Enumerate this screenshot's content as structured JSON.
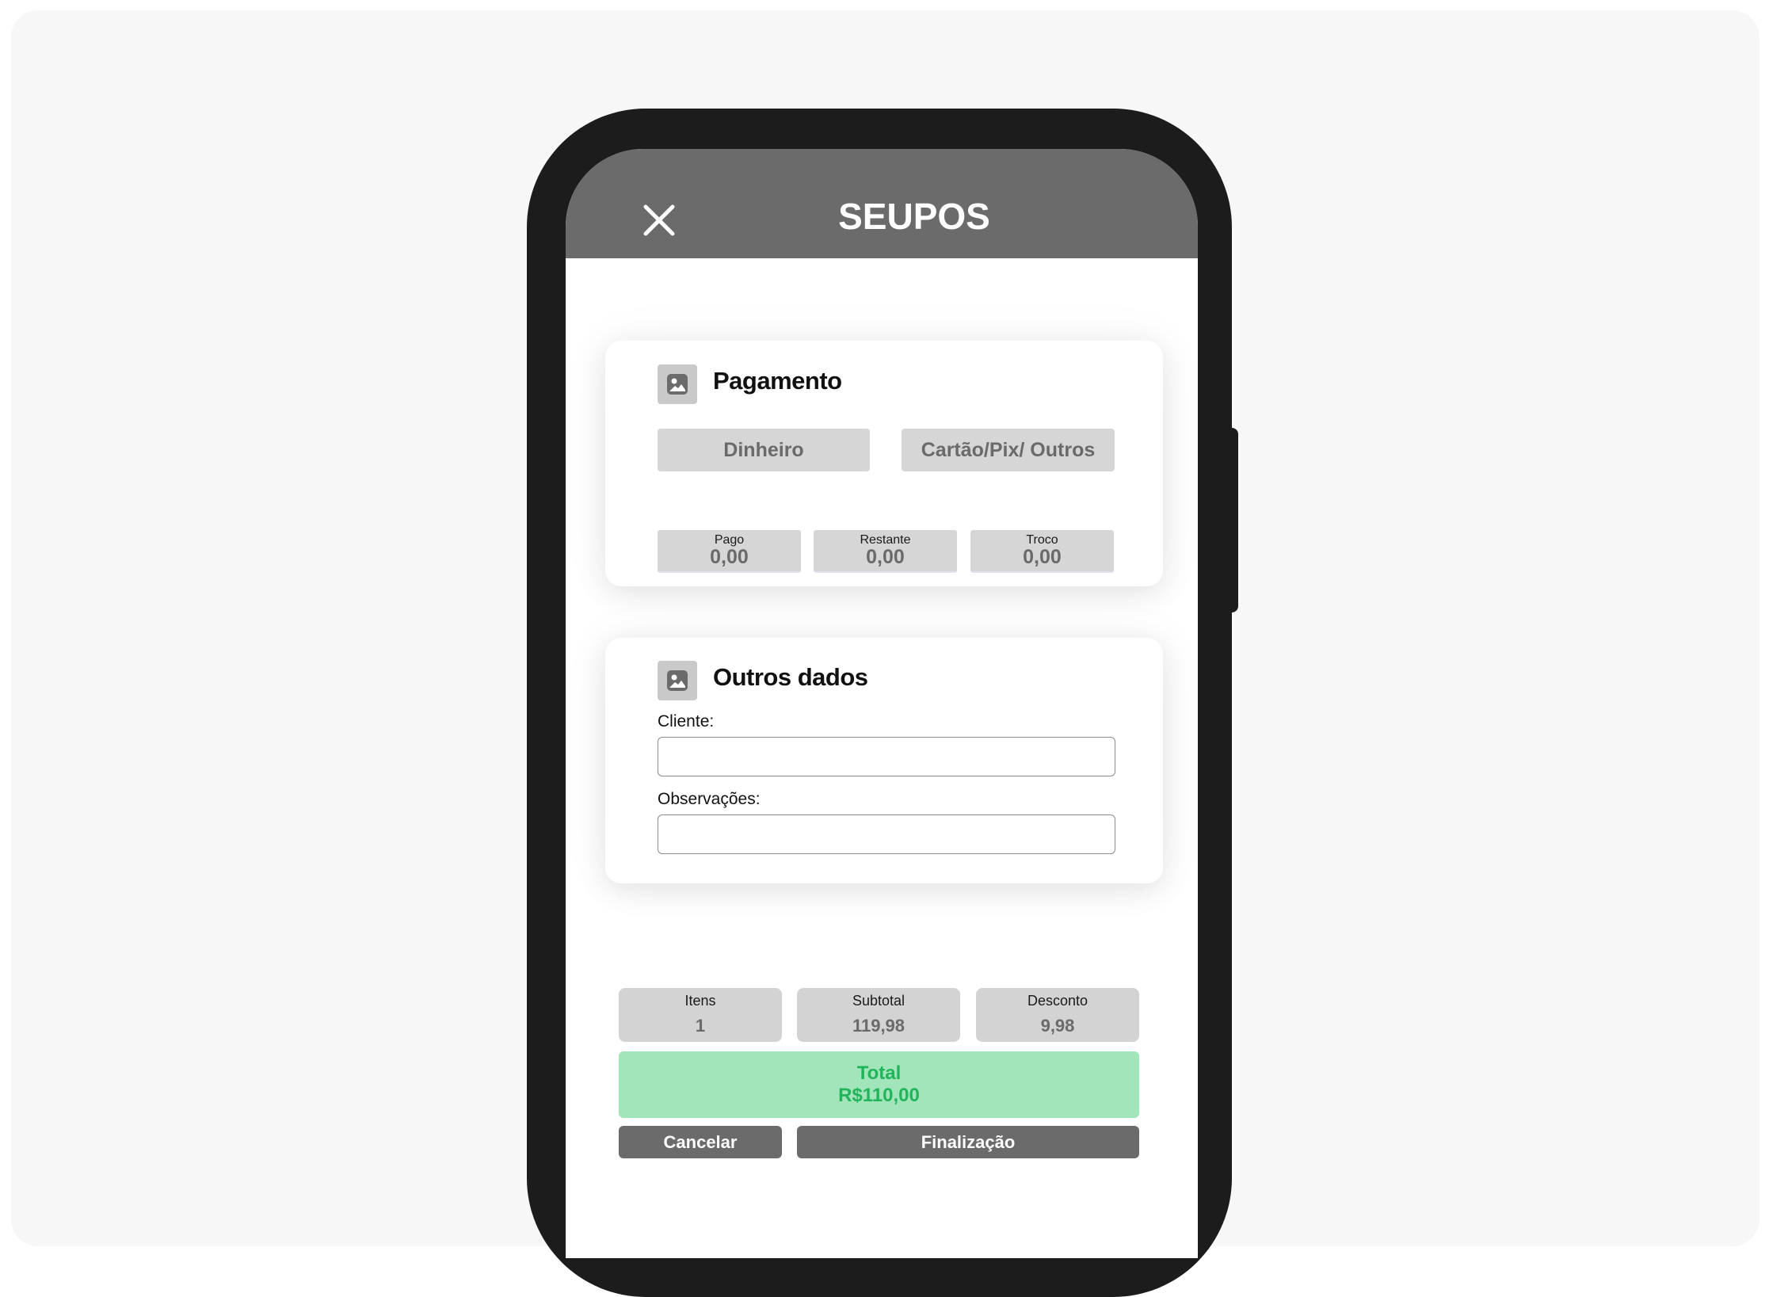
{
  "app": {
    "title": "SEUPOS",
    "close_icon": "close-icon"
  },
  "payment": {
    "title": "Pagamento",
    "icon": "image-icon",
    "methods": [
      "Dinheiro",
      "Cartão/Pix/ Outros"
    ],
    "fields": [
      {
        "label": "Pago",
        "value": "0,00"
      },
      {
        "label": "Restante",
        "value": "0,00"
      },
      {
        "label": "Troco",
        "value": "0,00"
      }
    ]
  },
  "other": {
    "title": "Outros dados",
    "icon": "image-icon",
    "cliente_label": "Cliente:",
    "cliente_value": "",
    "obs_label": "Observações:",
    "obs_value": ""
  },
  "summary": [
    {
      "label": "Itens",
      "value": "1"
    },
    {
      "label": "Subtotal",
      "value": "119,98"
    },
    {
      "label": "Desconto",
      "value": "9,98"
    }
  ],
  "total": {
    "label": "Total",
    "value": "R$110,00"
  },
  "actions": {
    "cancel": "Cancelar",
    "finish": "Finalização"
  },
  "colors": {
    "appbar": "#6b6b6b",
    "total_bg": "#a2e5bb",
    "total_text": "#21b45a",
    "button": "#6b6b6b",
    "chip": "#d6d6d6"
  }
}
